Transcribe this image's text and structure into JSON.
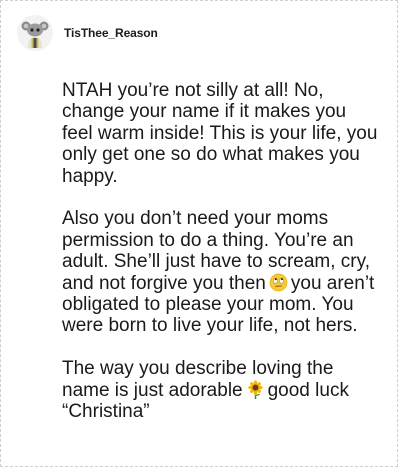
{
  "comment": {
    "username": "TisThee_Reason",
    "avatar_icon": "reddit-snoo-avatar-icon",
    "paragraphs": [
      {
        "text": "NTAH you’re not silly at all! No, change your name if it makes you feel warm inside! This is your life, you only get one so do what makes you happy."
      },
      {
        "before": "Also you don’t need your moms permission to do a thing. You’re an adult. She’ll just have to scream, cry, and not forgive you then",
        "emoji": "eye-roll-emoji",
        "after": "you aren’t obligated to please your mom. You were born to live your life, not hers."
      },
      {
        "before": "The way you describe loving the name is just adorable",
        "emoji": "sunflower-emoji",
        "after": "good luck “Christina”"
      }
    ]
  }
}
